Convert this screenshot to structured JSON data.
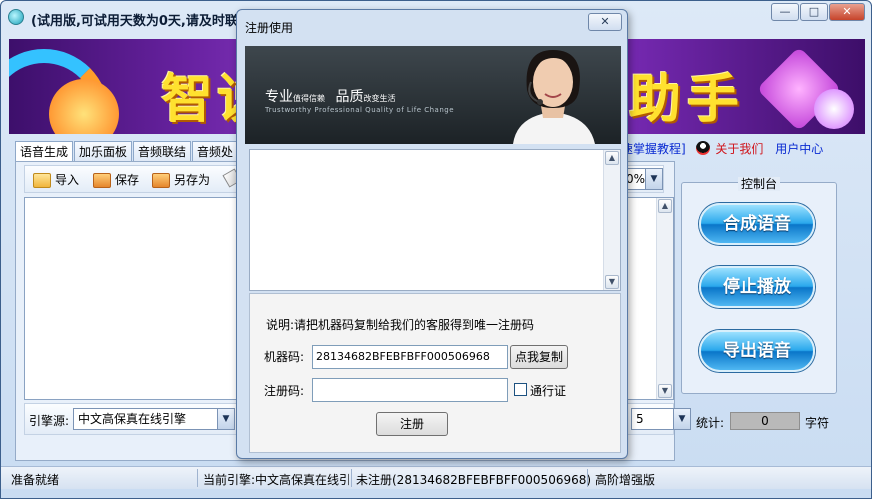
{
  "window": {
    "title": "(试用版,可试用天数为0天,请及时联",
    "controls": [
      "—",
      "□",
      "✕"
    ]
  },
  "banner": {
    "text_left": "智",
    "text_left2": "说",
    "text_right": "助手"
  },
  "tabs": [
    "语音生成",
    "加乐面板",
    "音频联结",
    "音频处"
  ],
  "links": {
    "tutorial": "速掌握教程]",
    "about": "关于我们",
    "user_center": "用户中心"
  },
  "toolbar": {
    "import": "导入",
    "save": "保存",
    "save_as": "另存为"
  },
  "engine": {
    "label": "引擎源:",
    "value": "中文高保真在线引擎"
  },
  "percent": {
    "value": "0%"
  },
  "speed": {
    "value": "5"
  },
  "stats": {
    "label": "统计:",
    "value": "0",
    "unit": "字符"
  },
  "control_panel": {
    "title": "控制台",
    "synthesize": "合成语音",
    "stop": "停止播放",
    "export": "导出语音"
  },
  "status": {
    "ready": "准备就绪",
    "engine": "当前引擎:中文高保真在线引",
    "registration": "未注册(28134682BFEBFBFF000506968)",
    "edition": "高阶增强版"
  },
  "dialog": {
    "title": "注册使用",
    "close": "✕",
    "slogan_main1": "专业",
    "slogan_small1": "值得信赖",
    "slogan_main2": "品质",
    "slogan_small2": "改变生活",
    "slogan_en": "Trustworthy  Professional  Quality  of  Life  Change",
    "instruction": "说明:请把机器码复制给我们的客服得到唯一注册码",
    "machine_code_label": "机器码:",
    "machine_code_value": "28134682BFEBFBFF000506968",
    "copy_button": "点我复制",
    "reg_code_label": "注册码:",
    "reg_code_value": "",
    "passport_label": "通行证",
    "register_button": "注册"
  }
}
